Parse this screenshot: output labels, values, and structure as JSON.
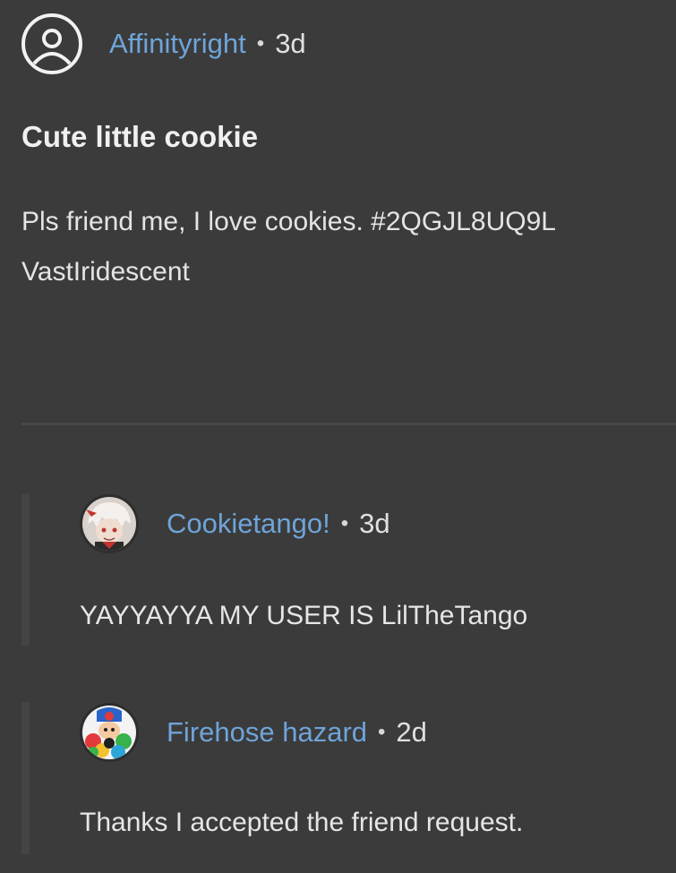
{
  "post": {
    "author": "Affinityright",
    "time": "3d",
    "separator": "•",
    "title": "Cute little cookie",
    "body_line_1": "Pls friend me, I love cookies. #2QGJL8UQ9L",
    "body_line_2": "VastIridescent",
    "avatar_icon": "user-circle-icon"
  },
  "comments": [
    {
      "author": "Cookietango!",
      "time": "3d",
      "separator": "•",
      "text": "YAYYAYYA MY USER IS LilTheTango"
    },
    {
      "author": "Firehose hazard",
      "time": "2d",
      "separator": "•",
      "text": "Thanks I accepted the friend request."
    }
  ],
  "colors": {
    "background": "#3b3b3b",
    "username": "#6fa4d9",
    "text": "#e6e6e6",
    "thread_line": "#444444"
  }
}
